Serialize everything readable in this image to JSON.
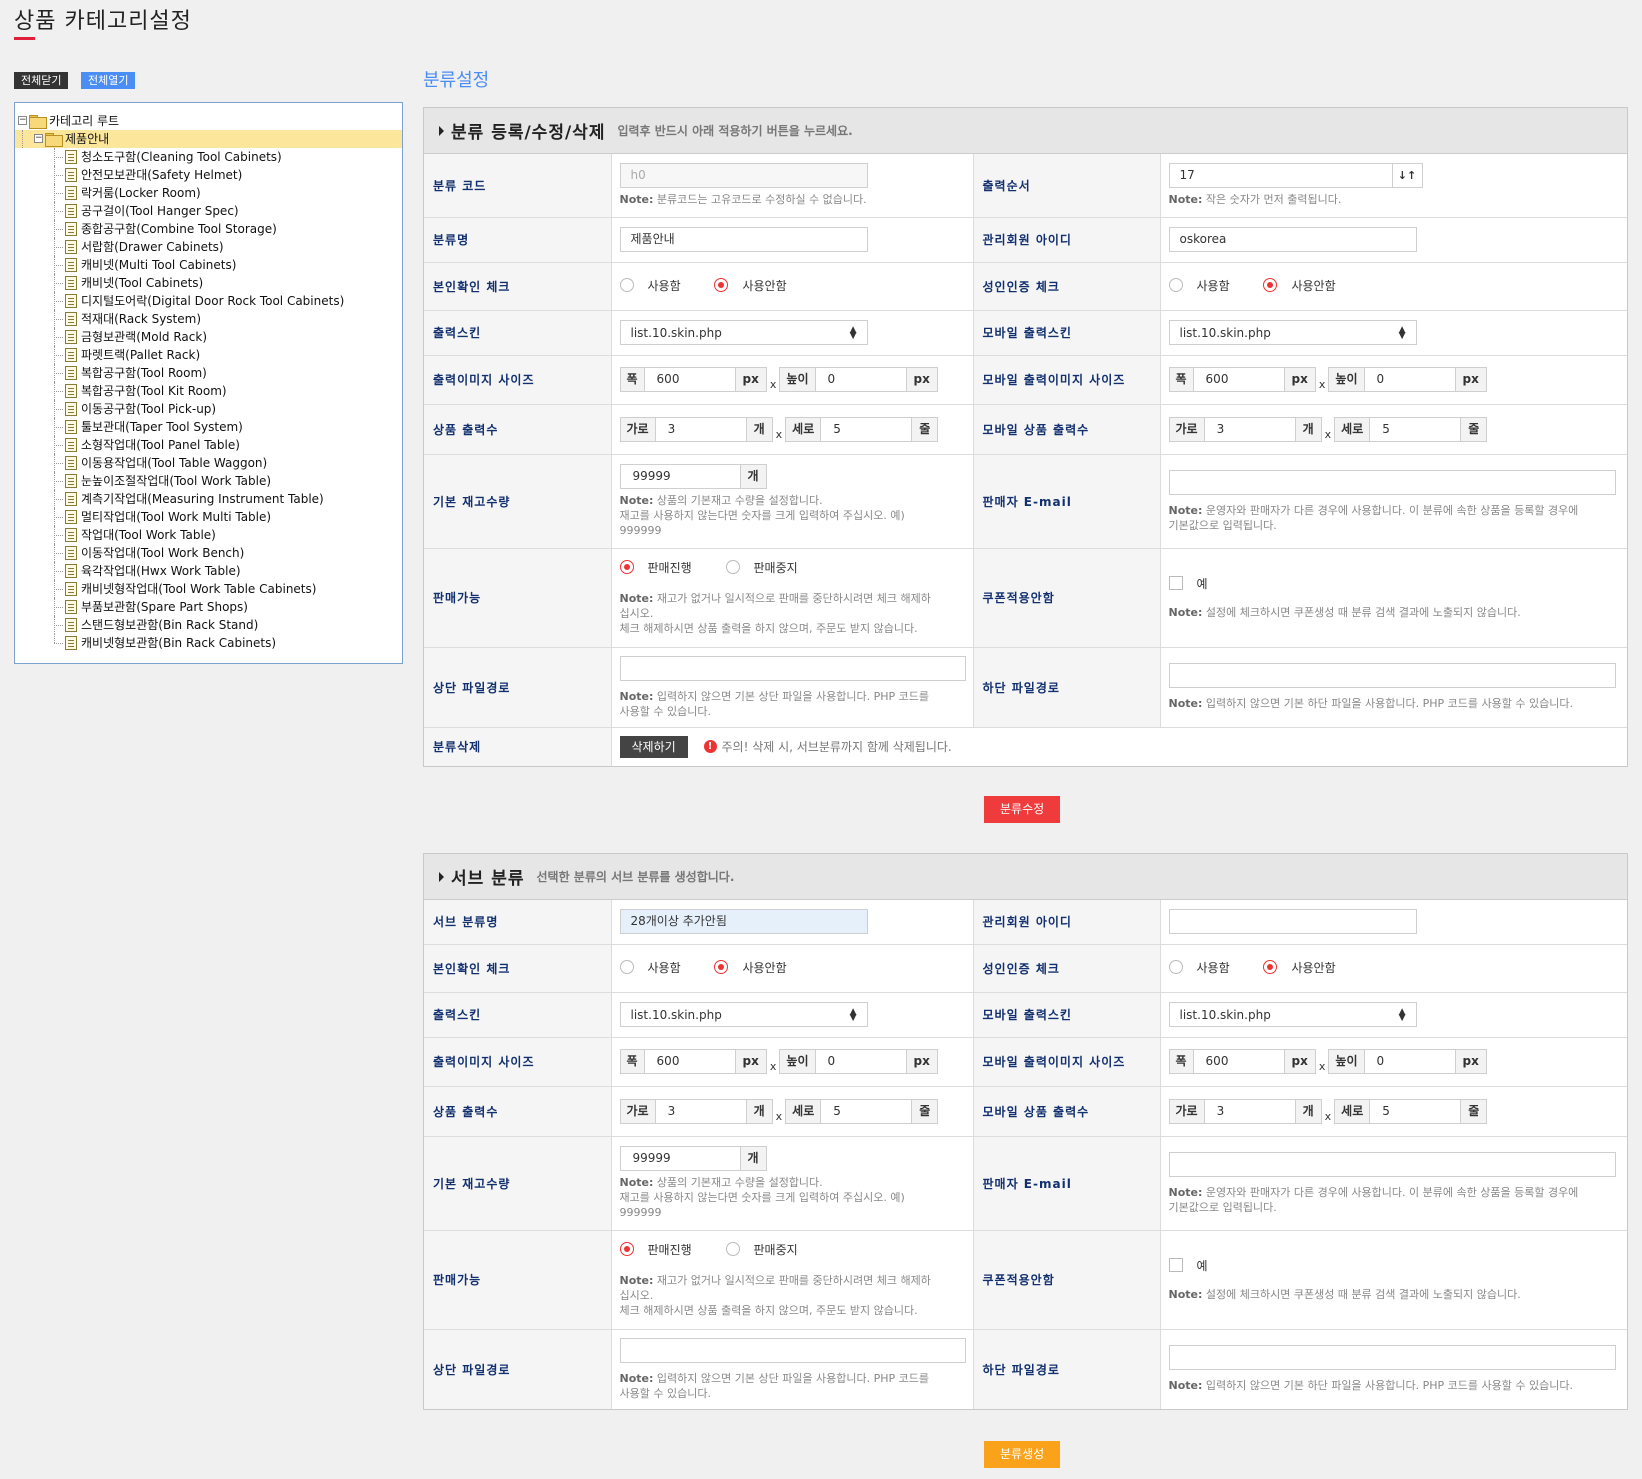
{
  "page": {
    "title": "상품 카테고리설정"
  },
  "tree_buttons": {
    "collapse_all": "전체닫기",
    "expand_all": "전체열기"
  },
  "tree": {
    "root": "카테고리 루트",
    "selected": "제품안내",
    "children": [
      "청소도구함(Cleaning Tool Cabinets)",
      "안전모보관대(Safety Helmet)",
      "락커룸(Locker Room)",
      "공구걸이(Tool Hanger Spec)",
      "종합공구함(Combine Tool Storage)",
      "서랍함(Drawer Cabinets)",
      "캐비넷(Multi Tool Cabinets)",
      "캐비넷(Tool Cabinets)",
      "디지털도어락(Digital Door Rock Tool Cabinets)",
      "적재대(Rack System)",
      "금형보관랙(Mold Rack)",
      "파렛트랙(Pallet Rack)",
      "복합공구함(Tool Room)",
      "복합공구함(Tool Kit Room)",
      "이동공구함(Tool Pick-up)",
      "툴보관대(Taper Tool System)",
      "소형작업대(Tool Panel Table)",
      "이동용작업대(Tool Table Waggon)",
      "눈높이조절작업대(Tool Work Table)",
      "계측기작업대(Measuring Instrument Table)",
      "멀티작업대(Tool Work Multi Table)",
      "작업대(Tool Work Table)",
      "이동작업대(Tool Work Bench)",
      "육각작업대(Hwx Work Table)",
      "캐비넷형작업대(Tool Work Table Cabinets)",
      "부품보관함(Spare Part Shops)",
      "스탠드형보관함(Bin Rack Stand)",
      "캐비넷형보관함(Bin Rack Cabinets)"
    ]
  },
  "section_title": "분류설정",
  "labels": {
    "identity_check": "본인확인 체크",
    "adult_check": "성인인증 체크",
    "use": "사용함",
    "not_use": "사용안함",
    "skin": "출력스킨",
    "mobile_skin": "모바일 출력스킨",
    "img_size": "출력이미지 사이즈",
    "mobile_img_size": "모바일 출력이미지 사이즈",
    "width": "폭",
    "height": "높이",
    "px": "px",
    "x": "x",
    "product_count": "상품 출력수",
    "mobile_product_count": "모바일 상품 출력수",
    "cols": "가로",
    "rows": "세로",
    "unit_ea": "개",
    "unit_row": "줄",
    "stock": "기본 재고수량",
    "seller_email": "판매자 E-mail",
    "sale": "판매가능",
    "on_sale": "판매진행",
    "stop_sale": "판매중지",
    "coupon": "쿠폰적용안함",
    "yes": "예",
    "top_file": "상단 파일경로",
    "bottom_file": "하단 파일경로",
    "admin_id": "관리회원 아이디",
    "note_prefix": "Note:",
    "note_stock_1": " 상품의 기본재고 수량을 설정합니다.",
    "note_stock_2": "재고를 사용하지 않는다면 숫자를 크게 입력하여 주십시오. 예)",
    "note_stock_3": "999999",
    "note_email_1": " 운영자와 판매자가 다른 경우에 사용합니다. 이 분류에 속한 상품을 등록할 경우에",
    "note_email_2": "기본값으로 입력됩니다.",
    "note_sale_1": " 재고가 없거나 일시적으로 판매를 중단하시려면 체크 해제하",
    "note_sale_2": "십시오.",
    "note_sale_3": "체크 해제하시면 상품 출력을 하지 않으며, 주문도 받지 않습니다.",
    "note_coupon": " 설정에 체크하시면 쿠폰생성 때 분류 검색 결과에 노출되지 않습니다.",
    "note_top_1": " 입력하지 않으면 기본 상단 파일을 사용합니다. PHP 코드를",
    "note_top_2": "사용할 수 있습니다.",
    "note_bottom": " 입력하지 않으면 기본 하단 파일을 사용합니다. PHP 코드를 사용할 수 있습니다."
  },
  "panel1": {
    "title": "분류 등록/수정/삭제",
    "subtitle": "입력후 반드시 아래 적용하기 버튼을 누르세요.",
    "code_label": "분류 코드",
    "code_value": "h0",
    "code_note": " 분류코드는 고유코드로 수정하실 수 없습니다.",
    "order_label": "출력순서",
    "order_value": "17",
    "order_btn": "↓↑",
    "order_note": " 작은 숫자가 먼저 출력됩니다.",
    "name_label": "분류명",
    "name_value": "제품안내",
    "admin_value": "oskorea",
    "skin_value": "list.10.skin.php",
    "mobile_skin_value": "list.10.skin.php",
    "img_w": "600",
    "img_h": "0",
    "m_img_w": "600",
    "m_img_h": "0",
    "cols": "3",
    "rows": "5",
    "m_cols": "3",
    "m_rows": "5",
    "stock": "99999",
    "delete_label": "분류삭제",
    "delete_btn": "삭제하기",
    "delete_warn": "주의! 삭제 시, 서브분류까지 함께 삭제됩니다.",
    "submit": "분류수정"
  },
  "panel2": {
    "title": "서브 분류",
    "subtitle": "선택한 분류의 서브 분류를 생성합니다.",
    "name_label": "서브 분류명",
    "name_value": "28개이상 추가안됨",
    "admin_value": "",
    "skin_value": "list.10.skin.php",
    "mobile_skin_value": "list.10.skin.php",
    "img_w": "600",
    "img_h": "0",
    "m_img_w": "600",
    "m_img_h": "0",
    "cols": "3",
    "rows": "5",
    "m_cols": "3",
    "m_rows": "5",
    "stock": "99999",
    "submit": "분류생성"
  }
}
